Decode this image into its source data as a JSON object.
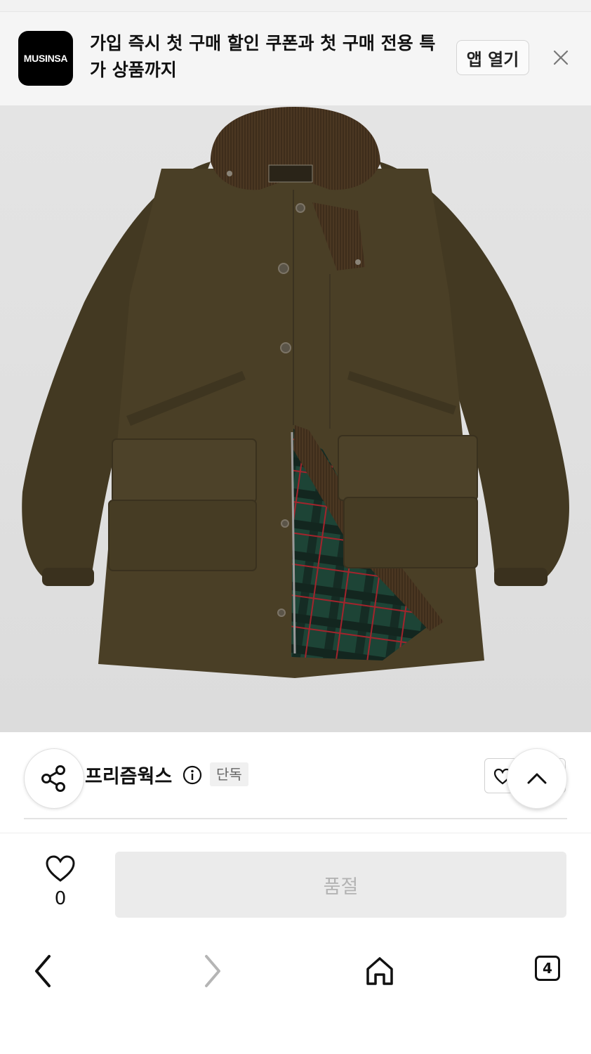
{
  "banner": {
    "logo_text": "MUSINSA",
    "message": "가입 즉시 첫 구매 할인 쿠폰과 첫 구매 전용 특가 상품까지",
    "open_app_label": "앱 열기"
  },
  "product": {
    "image_subject": "olive-brown-hunting-jacket",
    "label_text": "FRIZMWORKS",
    "brand_name": "프리즘웍스",
    "brand_tag": "단독"
  },
  "purchase": {
    "like_count": "0",
    "button_label": "품절"
  },
  "nav": {
    "tab_count": "4"
  },
  "colors": {
    "banner_bg": "#f5f5f5",
    "jacket_shell": "#4a3f26",
    "corduroy": "#4e3a25",
    "plaid_green": "#1f4a3a",
    "soldout_bg": "#ebebeb"
  }
}
